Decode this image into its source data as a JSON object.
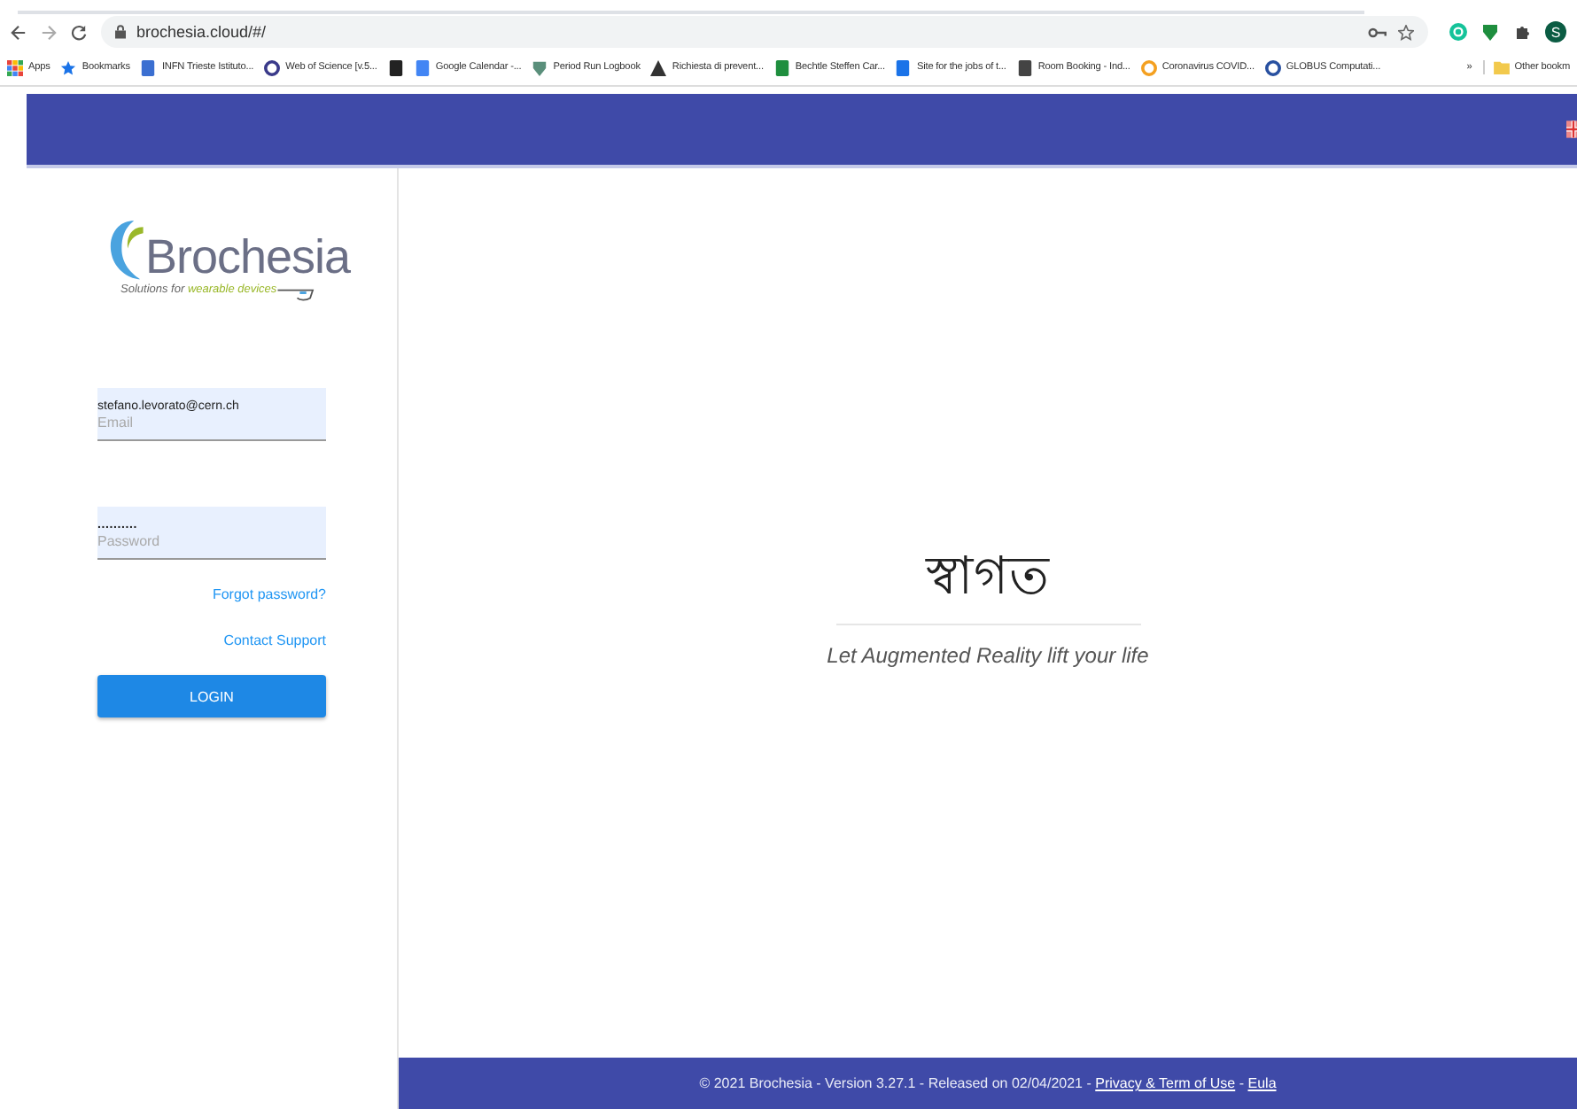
{
  "browser": {
    "url": "brochesia.cloud/#/",
    "bookmarks": [
      {
        "kind": "labeled",
        "label": "Apps"
      },
      {
        "kind": "labeled",
        "label": "Bookmarks"
      },
      {
        "kind": "labeled",
        "label": "INFN Trieste Istituto..."
      },
      {
        "kind": "labeled",
        "label": "Web of Science [v.5..."
      },
      {
        "kind": "icon"
      },
      {
        "kind": "labeled",
        "label": "Google Calendar -..."
      },
      {
        "kind": "labeled",
        "label": "Period Run Logbook"
      },
      {
        "kind": "labeled",
        "label": "Richiesta di prevent..."
      },
      {
        "kind": "labeled",
        "label": "Bechtle Steffen Car..."
      },
      {
        "kind": "labeled",
        "label": "Site for the jobs of t..."
      },
      {
        "kind": "labeled",
        "label": "Room Booking - Ind..."
      },
      {
        "kind": "labeled",
        "label": "Coronavirus COVID..."
      },
      {
        "kind": "labeled",
        "label": "GLOBUS Computati..."
      }
    ],
    "overflow": "»",
    "other": "Other bookm",
    "profile": "S"
  },
  "login": {
    "logo": "Brochesia",
    "tagline": {
      "text": "Solutions for",
      "highlight": "wearable devices"
    },
    "email": {
      "value": "stefano.levorato@cern.ch",
      "label": "Email"
    },
    "password": {
      "value": "..........",
      "label": "Password"
    },
    "links": [
      "Forgot password?",
      "Contact Support"
    ],
    "button": "LOGIN"
  },
  "welcome": {
    "title": "স্বাগত",
    "subtitle": "Let Augmented Reality lift your life"
  },
  "footer": [
    {
      "kind": "text",
      "text": "© 2021 Brochesia - Version 3.27.1 - Released on 02/04/2021 -"
    },
    {
      "kind": "link",
      "text": "Privacy & Term of Use"
    },
    {
      "kind": "text",
      "text": "-"
    },
    {
      "kind": "link",
      "text": "Eula"
    }
  ]
}
